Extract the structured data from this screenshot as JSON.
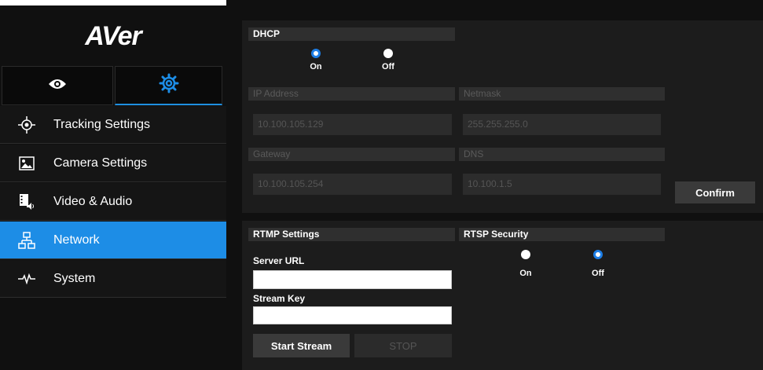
{
  "brand": {
    "logo": "AVer"
  },
  "sidebar": {
    "tabs": [
      {
        "icon": "eye-icon"
      },
      {
        "icon": "gear-icon"
      }
    ],
    "items": [
      {
        "label": "Tracking Settings",
        "icon": "crosshair-icon"
      },
      {
        "label": "Camera Settings",
        "icon": "image-icon"
      },
      {
        "label": "Video & Audio",
        "icon": "film-audio-icon"
      },
      {
        "label": "Network",
        "icon": "network-icon"
      },
      {
        "label": "System",
        "icon": "pulse-icon"
      }
    ]
  },
  "dhcp": {
    "title": "DHCP",
    "on_label": "On",
    "off_label": "Off",
    "selected": "On"
  },
  "ip": {
    "ip_label": "IP Address",
    "ip_value": "10.100.105.129",
    "netmask_label": "Netmask",
    "netmask_value": "255.255.255.0",
    "gateway_label": "Gateway",
    "gateway_value": "10.100.105.254",
    "dns_label": "DNS",
    "dns_value": "10.100.1.5",
    "confirm_label": "Confirm"
  },
  "rtmp": {
    "title": "RTMP Settings",
    "server_url_label": "Server URL",
    "server_url_value": "",
    "stream_key_label": "Stream Key",
    "stream_key_value": "",
    "start_label": "Start Stream",
    "stop_label": "STOP"
  },
  "rtsp": {
    "title": "RTSP Security",
    "on_label": "On",
    "off_label": "Off",
    "selected": "Off"
  },
  "colors": {
    "accent": "#1d8de6",
    "background": "#101010"
  }
}
